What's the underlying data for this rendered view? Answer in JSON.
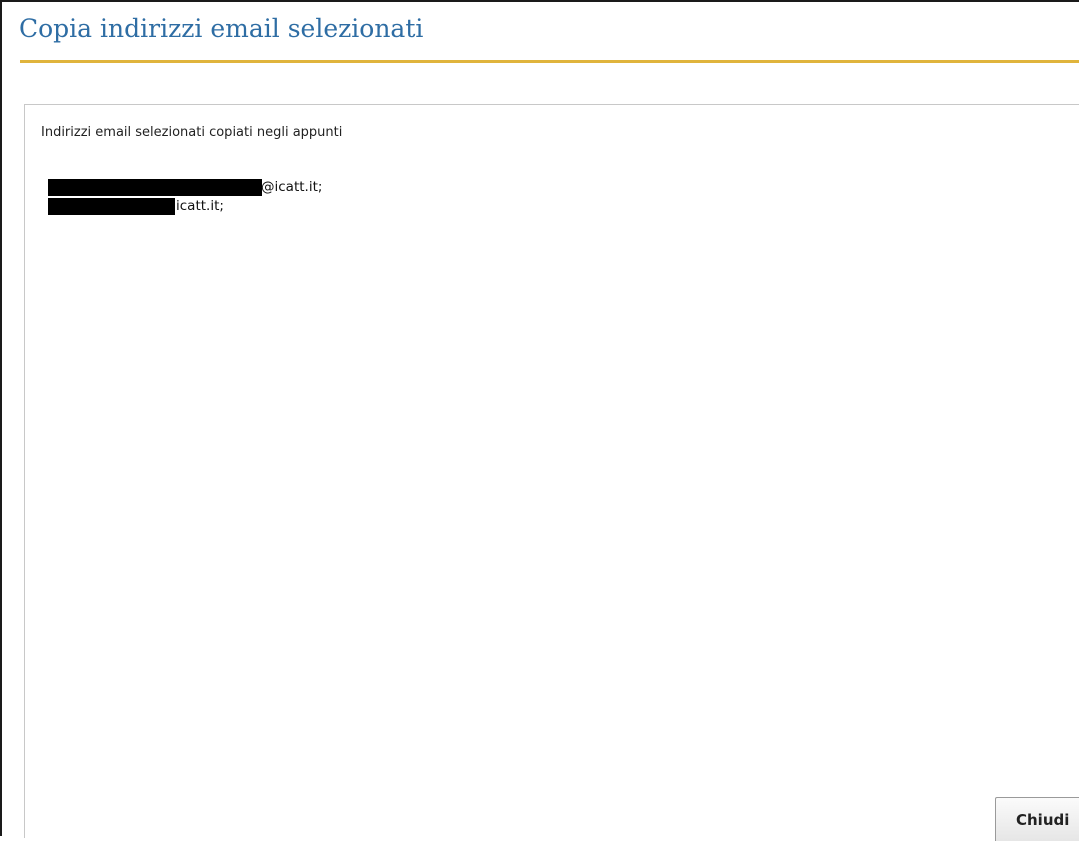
{
  "dialog": {
    "title": "Copia indirizzi email selezionati",
    "message": "Indirizzi email selezionati copiati negli appunti",
    "emails": [
      {
        "visible_text": "@icatt.it;"
      },
      {
        "visible_text": "icatt.it;"
      }
    ],
    "close_label": "Chiudi"
  },
  "colors": {
    "title": "#2e6da4",
    "title_rule": "#e0b43c",
    "redaction": "#000000"
  }
}
